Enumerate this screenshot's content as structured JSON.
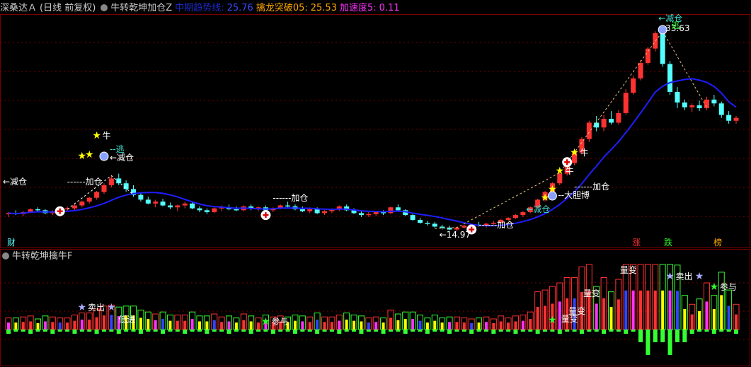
{
  "header_main": {
    "stock": "深桑达Ａ",
    "period": "(日线 前复权)",
    "indicator": "牛转乾坤加仓Z",
    "line1_label": "中期趋势线:",
    "line1_value": "25.76",
    "line2_label": "擒龙突破05:",
    "line2_value": "25.53",
    "line3_label": "加速度5:",
    "line3_value": "0.11"
  },
  "header_sub": {
    "indicator": "牛转乾坤擒牛F"
  },
  "colors": {
    "bg": "#000000",
    "up": "#ff3232",
    "down": "#54ffff",
    "trend": "#1e1eff",
    "grid": "#7a0000",
    "white": "#ffffff",
    "yellow": "#ffff00",
    "magenta": "#ff33ff",
    "green": "#33ff33",
    "orange": "#ffa500",
    "teal": "#40e0d0"
  },
  "bottom_markers": [
    {
      "label": "财",
      "color": "#54ffff"
    },
    {
      "label": "涨",
      "color": "#ff3232"
    },
    {
      "label": "跌",
      "color": "#33ff33"
    },
    {
      "label": "榜",
      "color": "#ffa500"
    }
  ],
  "annotations": {
    "price_low": "14.97",
    "price_high": "33.63",
    "add_pos": "加仓",
    "reduce_pos": "减仓",
    "escape": "逃",
    "bull": "牛",
    "bold_bet": "大胆博",
    "sell": "卖出",
    "low_buy": "低进",
    "join": "参与",
    "change": "量变"
  },
  "chart_data": {
    "type": "candlestick",
    "candles": [
      [
        14.6,
        14.8,
        14.3,
        14.7
      ],
      [
        14.7,
        15.0,
        14.5,
        14.6
      ],
      [
        14.6,
        14.9,
        14.4,
        14.8
      ],
      [
        14.8,
        15.2,
        14.7,
        15.1
      ],
      [
        15.1,
        15.3,
        14.9,
        15.0
      ],
      [
        15.0,
        15.1,
        14.6,
        14.7
      ],
      [
        14.7,
        15.0,
        14.5,
        14.9
      ],
      [
        14.9,
        15.2,
        14.8,
        15.1
      ],
      [
        15.1,
        15.4,
        14.9,
        15.2
      ],
      [
        15.2,
        15.6,
        15.0,
        15.5
      ],
      [
        15.5,
        16.0,
        15.3,
        15.9
      ],
      [
        15.9,
        16.4,
        15.7,
        16.3
      ],
      [
        16.3,
        17.0,
        16.1,
        16.9
      ],
      [
        16.9,
        17.8,
        16.7,
        17.6
      ],
      [
        17.6,
        18.6,
        17.4,
        18.3
      ],
      [
        18.3,
        18.8,
        17.6,
        17.8
      ],
      [
        17.8,
        18.1,
        16.9,
        17.2
      ],
      [
        17.2,
        17.6,
        16.4,
        16.6
      ],
      [
        16.6,
        16.8,
        15.9,
        16.1
      ],
      [
        16.1,
        16.4,
        15.6,
        15.7
      ],
      [
        15.7,
        16.1,
        15.3,
        15.9
      ],
      [
        15.9,
        16.2,
        15.4,
        15.5
      ],
      [
        15.5,
        15.8,
        15.1,
        15.3
      ],
      [
        15.3,
        15.6,
        14.9,
        15.5
      ],
      [
        15.5,
        15.9,
        15.2,
        15.7
      ],
      [
        15.7,
        15.8,
        15.1,
        15.2
      ],
      [
        15.2,
        15.4,
        14.8,
        15.0
      ],
      [
        15.0,
        15.2,
        14.6,
        14.8
      ],
      [
        14.8,
        15.3,
        14.7,
        15.2
      ],
      [
        15.2,
        15.5,
        14.9,
        15.3
      ],
      [
        15.3,
        15.6,
        15.0,
        15.1
      ],
      [
        15.1,
        15.4,
        14.9,
        15.0
      ],
      [
        15.0,
        15.5,
        14.9,
        15.4
      ],
      [
        15.4,
        15.6,
        15.0,
        15.2
      ],
      [
        15.2,
        15.4,
        14.9,
        15.3
      ],
      [
        15.3,
        15.5,
        14.9,
        15.0
      ],
      [
        15.0,
        15.3,
        14.8,
        15.2
      ],
      [
        15.2,
        15.6,
        15.1,
        15.5
      ],
      [
        15.5,
        15.9,
        15.3,
        15.4
      ],
      [
        15.4,
        15.6,
        15.0,
        15.1
      ],
      [
        15.1,
        15.4,
        14.8,
        14.9
      ],
      [
        14.9,
        15.2,
        14.7,
        15.1
      ],
      [
        15.1,
        15.3,
        14.6,
        14.7
      ],
      [
        14.7,
        15.0,
        14.5,
        14.9
      ],
      [
        14.9,
        15.2,
        14.7,
        15.1
      ],
      [
        15.1,
        15.5,
        14.9,
        15.4
      ],
      [
        15.4,
        15.6,
        14.9,
        15.0
      ],
      [
        15.0,
        15.2,
        14.6,
        14.7
      ],
      [
        14.7,
        14.9,
        14.3,
        14.5
      ],
      [
        14.5,
        14.8,
        14.3,
        14.6
      ],
      [
        14.6,
        14.9,
        14.4,
        14.8
      ],
      [
        14.8,
        15.0,
        14.5,
        14.7
      ],
      [
        14.7,
        15.4,
        14.6,
        15.3
      ],
      [
        15.3,
        15.6,
        14.9,
        15.0
      ],
      [
        15.0,
        15.1,
        14.4,
        14.5
      ],
      [
        14.5,
        14.6,
        13.9,
        14.0
      ],
      [
        14.0,
        14.2,
        13.6,
        13.7
      ],
      [
        13.7,
        13.9,
        13.4,
        13.6
      ],
      [
        13.6,
        13.8,
        13.2,
        13.3
      ],
      [
        13.3,
        13.5,
        13.0,
        13.2
      ],
      [
        13.2,
        13.4,
        12.9,
        13.0
      ],
      [
        13.0,
        13.3,
        12.8,
        13.2
      ],
      [
        13.2,
        13.5,
        13.1,
        13.4
      ],
      [
        13.4,
        13.6,
        13.2,
        13.5
      ],
      [
        13.5,
        13.8,
        13.3,
        13.4
      ],
      [
        13.4,
        13.7,
        13.2,
        13.6
      ],
      [
        13.6,
        13.9,
        13.5,
        13.7
      ],
      [
        13.7,
        14.1,
        13.6,
        14.0
      ],
      [
        14.0,
        14.3,
        13.9,
        14.2
      ],
      [
        14.2,
        14.6,
        14.1,
        14.5
      ],
      [
        14.5,
        14.9,
        14.3,
        14.8
      ],
      [
        14.8,
        15.4,
        14.7,
        15.3
      ],
      [
        15.3,
        16.2,
        15.2,
        16.1
      ],
      [
        16.1,
        17.0,
        15.9,
        16.9
      ],
      [
        16.9,
        17.9,
        16.7,
        17.8
      ],
      [
        17.8,
        18.9,
        17.6,
        18.8
      ],
      [
        18.8,
        20.1,
        18.6,
        19.9
      ],
      [
        19.9,
        21.2,
        19.7,
        21.0
      ],
      [
        21.0,
        22.6,
        20.8,
        22.4
      ],
      [
        22.4,
        24.3,
        22.1,
        24.1
      ],
      [
        24.1,
        24.8,
        23.2,
        23.6
      ],
      [
        23.6,
        24.9,
        23.2,
        24.5
      ],
      [
        24.5,
        25.3,
        23.9,
        24.1
      ],
      [
        24.1,
        25.4,
        23.9,
        25.1
      ],
      [
        25.1,
        27.6,
        24.9,
        27.2
      ],
      [
        27.2,
        29.0,
        27.0,
        28.7
      ],
      [
        28.7,
        30.6,
        28.5,
        30.3
      ],
      [
        30.3,
        32.0,
        30.1,
        31.8
      ],
      [
        31.8,
        33.6,
        31.5,
        33.4
      ],
      [
        33.4,
        33.63,
        29.9,
        30.2
      ],
      [
        30.2,
        30.5,
        27.0,
        27.3
      ],
      [
        27.3,
        27.8,
        25.6,
        26.2
      ],
      [
        26.2,
        26.5,
        25.4,
        25.7
      ],
      [
        25.7,
        26.1,
        25.2,
        25.9
      ],
      [
        25.9,
        26.4,
        25.3,
        25.6
      ],
      [
        25.6,
        26.8,
        25.4,
        26.5
      ],
      [
        26.5,
        27.0,
        25.8,
        26.1
      ],
      [
        26.1,
        26.3,
        24.6,
        24.9
      ],
      [
        24.9,
        25.3,
        24.0,
        24.3
      ],
      [
        24.3,
        24.8,
        24.0,
        24.6
      ]
    ]
  }
}
